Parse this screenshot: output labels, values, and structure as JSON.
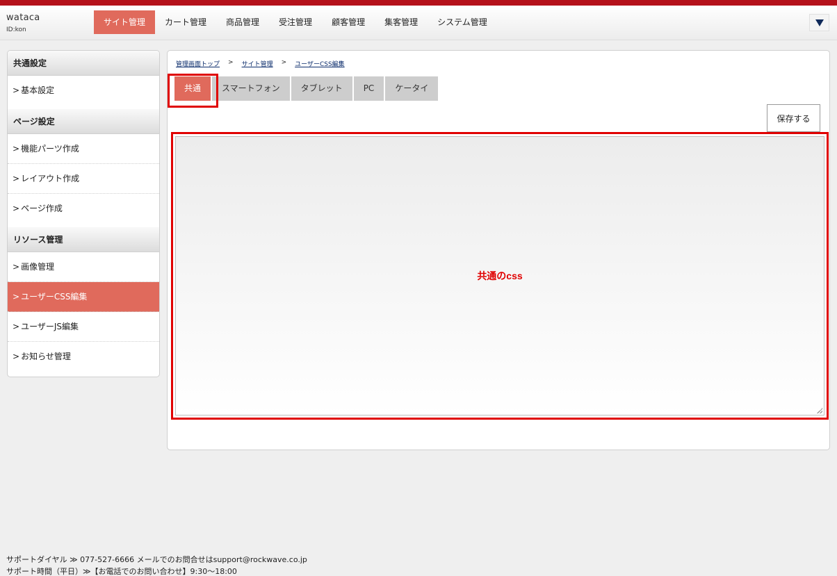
{
  "header": {
    "brand": "wataca",
    "user_id": "ID:kon",
    "nav": [
      {
        "label": "サイト管理",
        "active": true
      },
      {
        "label": "カート管理"
      },
      {
        "label": "商品管理"
      },
      {
        "label": "受注管理"
      },
      {
        "label": "顧客管理"
      },
      {
        "label": "集客管理"
      },
      {
        "label": "システム管理"
      }
    ]
  },
  "sidebar": {
    "sections": [
      {
        "title": "共通設定",
        "items": [
          {
            "label": "基本設定"
          }
        ]
      },
      {
        "title": "ページ設定",
        "items": [
          {
            "label": "機能パーツ作成"
          },
          {
            "label": "レイアウト作成"
          },
          {
            "label": "ページ作成"
          }
        ]
      },
      {
        "title": "リソース管理",
        "items": [
          {
            "label": "画像管理"
          },
          {
            "label": "ユーザーCSS編集",
            "active": true
          },
          {
            "label": "ユーザーJS編集"
          },
          {
            "label": "お知らせ管理"
          }
        ]
      }
    ],
    "chevron": ">"
  },
  "breadcrumb": {
    "items": [
      "管理画面トップ",
      "サイト管理",
      "ユーザーCSS編集"
    ],
    "separator": ">"
  },
  "tabs": [
    {
      "label": "共通",
      "active": true
    },
    {
      "label": "スマートフォン"
    },
    {
      "label": "タブレット"
    },
    {
      "label": "PC"
    },
    {
      "label": "ケータイ"
    }
  ],
  "save_button": "保存する",
  "editor": {
    "annotation": "共通のcss",
    "value": ""
  },
  "footer": {
    "line1": "サポートダイヤル ≫ 077-527-6666  メールでのお問合せはsupport@rockwave.co.jp",
    "line2": "サポート時間（平日）≫【お電話でのお問い合わせ】9:30～18:00"
  },
  "colors": {
    "accent": "#e06a5c",
    "topbar": "#b5121b",
    "highlight": "#e00000"
  }
}
